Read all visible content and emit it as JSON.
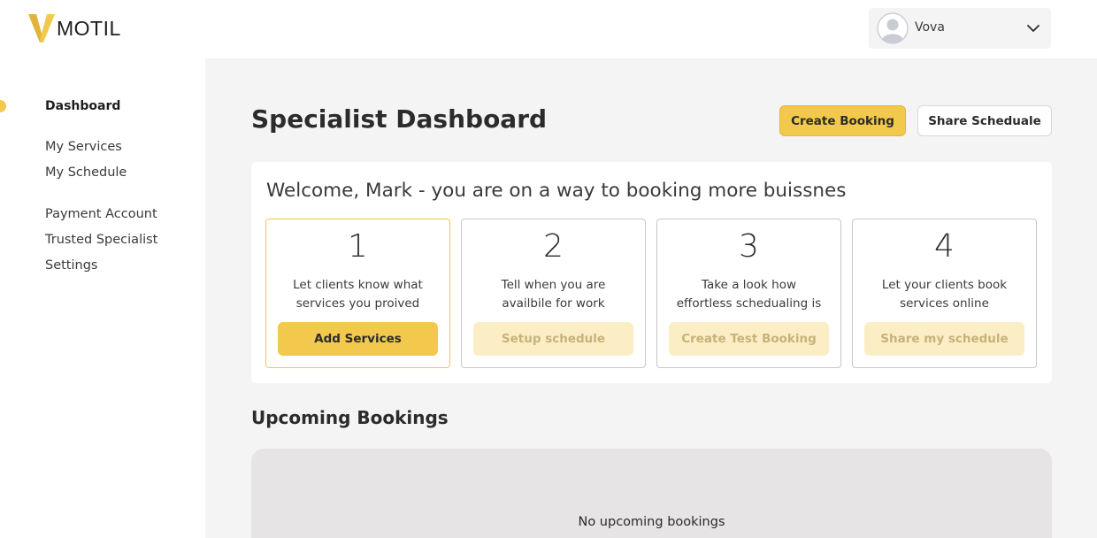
{
  "brand": {
    "name": "MOTIL",
    "accent": "#f2c94c"
  },
  "sidebar": {
    "items": [
      {
        "label": "Dashboard",
        "active": true
      },
      {
        "label": "My Services"
      },
      {
        "label": "My Schedule"
      },
      {
        "label": "Payment Account"
      },
      {
        "label": "Trusted Specialist"
      },
      {
        "label": "Settings"
      }
    ]
  },
  "user_menu": {
    "name": "Vova",
    "icon": "chevron-down-icon"
  },
  "header": {
    "title": "Specialist Dashboard",
    "create_label": "Create Booking",
    "share_label": "Share Scheduale"
  },
  "welcome": {
    "text": "Welcome, Mark - you are on a way to booking more buissnes",
    "steps": [
      {
        "num": "1",
        "line1": "Let clients know what",
        "line2": "services you proived",
        "button": "Add Services",
        "state": "primary"
      },
      {
        "num": "2",
        "line1": "Tell when you are",
        "line2": "availbile for work",
        "button": "Setup schedule",
        "state": "muted"
      },
      {
        "num": "3",
        "line1": "Take a look how",
        "line2": "effortless schedualing is",
        "button": "Create Test Booking",
        "state": "muted"
      },
      {
        "num": "4",
        "line1": "Let your clients book",
        "line2": "services online",
        "button": "Share my schedule",
        "state": "muted"
      }
    ]
  },
  "bookings": {
    "title": "Upcoming Bookings",
    "empty_text": "No upcoming bookings"
  }
}
